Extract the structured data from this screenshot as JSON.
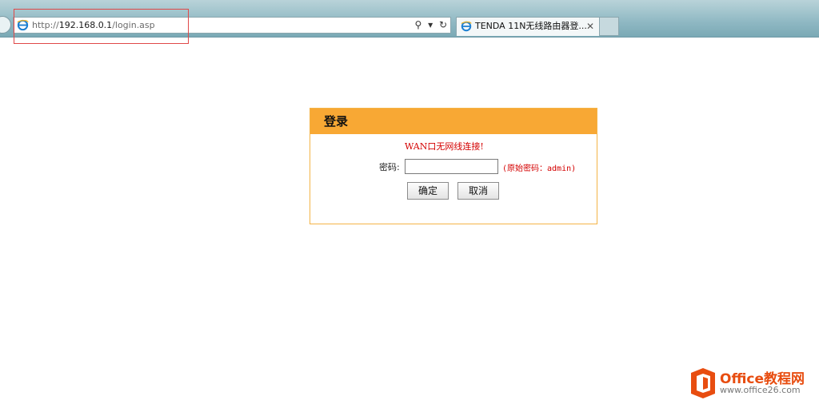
{
  "browser": {
    "url_prefix": "http://",
    "url_host": "192.168.0.1",
    "url_path": "/login.asp",
    "tab_title": "TENDA 11N无线路由器登...",
    "tab_close": "✕",
    "search_glyph": "⚲",
    "dropdown_glyph": "▾",
    "refresh_glyph": "↻"
  },
  "login": {
    "title": "登录",
    "wan_message": "WAN口无网线连接!",
    "password_label": "密码:",
    "password_value": "",
    "password_hint": "(原始密码：admin)",
    "ok_button": "确定",
    "cancel_button": "取消"
  },
  "watermark": {
    "brand": "Office教程网",
    "site": "www.office26.com"
  },
  "colors": {
    "header_orange": "#f8a834",
    "panel_border": "#f4b447",
    "error_red": "#d40000",
    "highlight_red": "#e04848",
    "watermark_orange": "#e84d10"
  }
}
